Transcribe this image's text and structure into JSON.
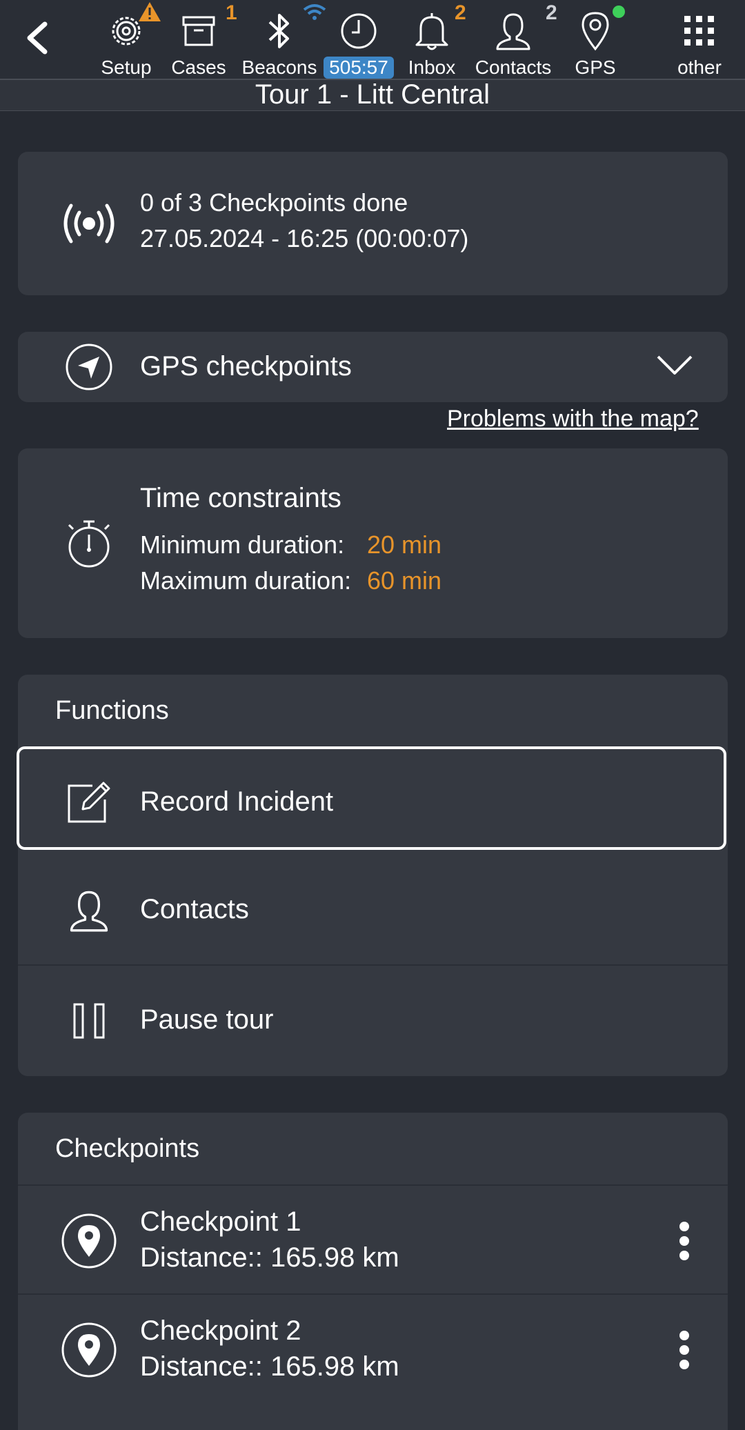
{
  "header": {
    "nav": [
      {
        "label": "Setup",
        "icon": "gear-icon",
        "warning": "!"
      },
      {
        "label": "Cases",
        "icon": "box-icon",
        "badge": "1"
      },
      {
        "label": "Beacons",
        "icon": "bluetooth-icon"
      },
      {
        "label": "",
        "icon": "clock-icon",
        "timer": "505:57"
      },
      {
        "label": "Inbox",
        "icon": "bell-icon",
        "badge": "2"
      },
      {
        "label": "Contacts",
        "icon": "person-icon",
        "badge": "2"
      },
      {
        "label": "GPS",
        "icon": "location-pin-icon"
      },
      {
        "label": "other",
        "icon": "grid-icon"
      }
    ],
    "title": "Tour 1 - Litt Central"
  },
  "status": {
    "line1": "0 of 3 Checkpoints done",
    "line2": "27.05.2024 - 16:25 (00:00:07)"
  },
  "gps": {
    "label": "GPS checkpoints",
    "link": "Problems with the map?"
  },
  "time": {
    "title": "Time constraints",
    "min_label": "Minimum duration:",
    "min_value": "20 min",
    "max_label": "Maximum duration:",
    "max_value": "60 min"
  },
  "functions": {
    "title": "Functions",
    "items": [
      {
        "label": "Record Incident",
        "icon": "edit-icon"
      },
      {
        "label": "Contacts",
        "icon": "person-icon"
      },
      {
        "label": "Pause tour",
        "icon": "pause-icon"
      }
    ]
  },
  "checkpoints": {
    "title": "Checkpoints",
    "items": [
      {
        "name": "Checkpoint 1",
        "distance": "Distance:: 165.98 km"
      },
      {
        "name": "Checkpoint 2",
        "distance": "Distance:: 165.98 km"
      }
    ]
  },
  "colors": {
    "accent": "#e8942a",
    "timer": "#3d86c6",
    "gps_dot": "#3ecf5a",
    "wifi": "#3d86c6"
  }
}
